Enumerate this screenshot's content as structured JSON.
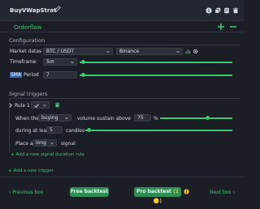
{
  "header": {
    "title": "BuyVWapStrat"
  },
  "tabs": {
    "active": "Orderflow"
  },
  "configuration": {
    "title": "Configuration",
    "market_label": "Market datas",
    "pair": "BTC / USDT",
    "exchange": "Binance",
    "timeframe_label": "Timeframe",
    "timeframe": "5m",
    "sma_label_hl": "SMA",
    "sma_label_rest": " Period",
    "sma_value": "7"
  },
  "signal_triggers": {
    "title": "Signal triggers",
    "rule_label": "Rule 1",
    "when_the": "When the",
    "side": "buying",
    "volume_text": "volume sustain above",
    "threshold": "75",
    "percent": "%",
    "during_text": "during at least",
    "candles_value": "5",
    "candles_text": "candles",
    "place_a": "Place a",
    "position": "long",
    "signal_text": "signal",
    "add_duration_rule": "Add a new signal duration rule",
    "add_trigger": "Add a new trigger"
  },
  "footer": {
    "prev": "Previous box",
    "free": "Free backtest",
    "pro": "Pro backtest",
    "pro_badge": "(1",
    "next": "Next box"
  },
  "colors": {
    "accent": "#3ec774",
    "background": "#1b1e25",
    "panel": "#232730"
  }
}
